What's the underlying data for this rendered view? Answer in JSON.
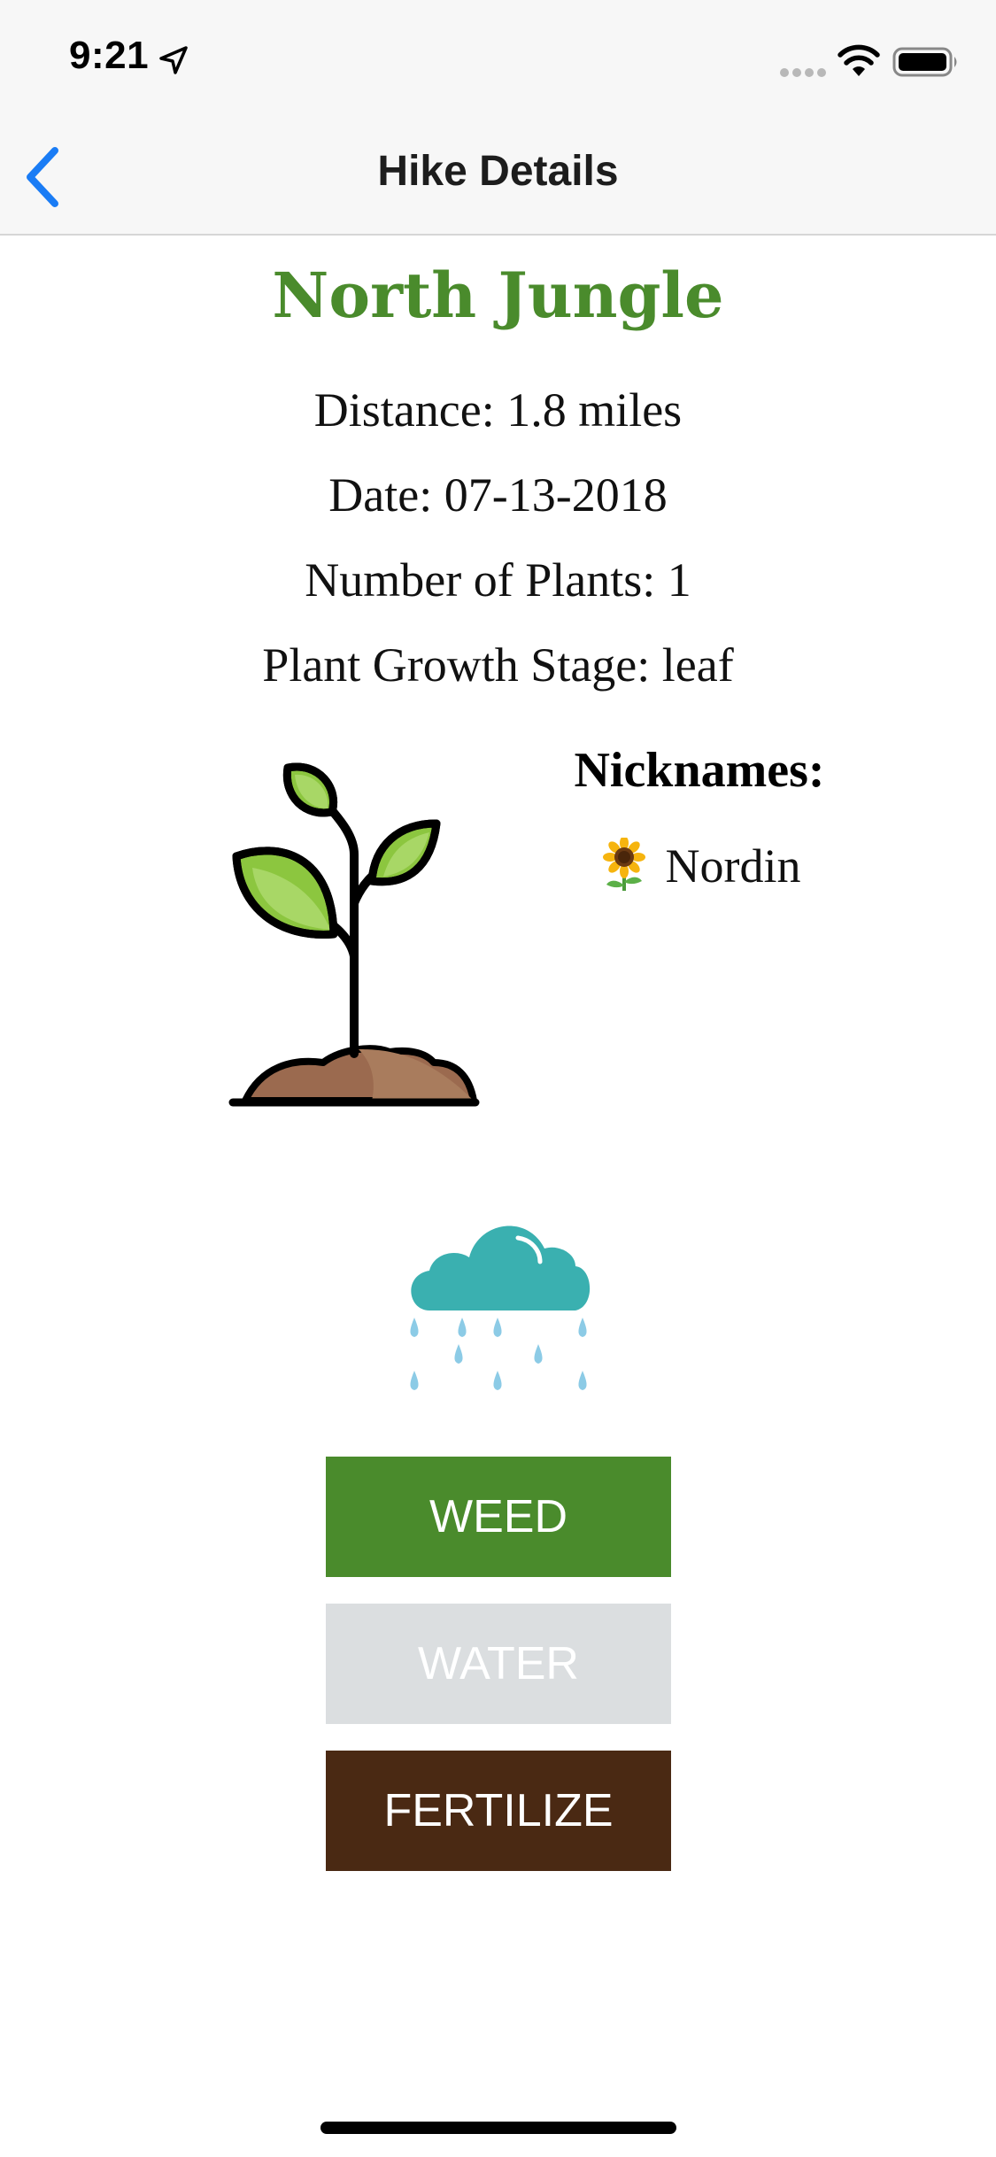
{
  "status_bar": {
    "time": "9:21"
  },
  "nav": {
    "title": "Hike Details"
  },
  "hike": {
    "name": "North Jungle",
    "distance": "Distance: 1.8 miles",
    "date": "Date: 07-13-2018",
    "num_plants": "Number of Plants: 1",
    "growth_stage": "Plant Growth Stage: leaf"
  },
  "nicknames": {
    "heading": "Nicknames:",
    "items": [
      {
        "icon": "sunflower-icon",
        "name": "Nordin"
      }
    ]
  },
  "actions": {
    "weed_label": "WEED",
    "water_label": "WATER",
    "fertilize_label": "FERTILIZE"
  },
  "colors": {
    "accent_green": "#4a8b2c",
    "water_disabled": "#dbdee0",
    "fertilize_brown": "#4a2913",
    "ios_blue": "#1a7cf5",
    "rain_cloud": "#3ab0b0",
    "rain_drop": "#8ccbe6"
  }
}
